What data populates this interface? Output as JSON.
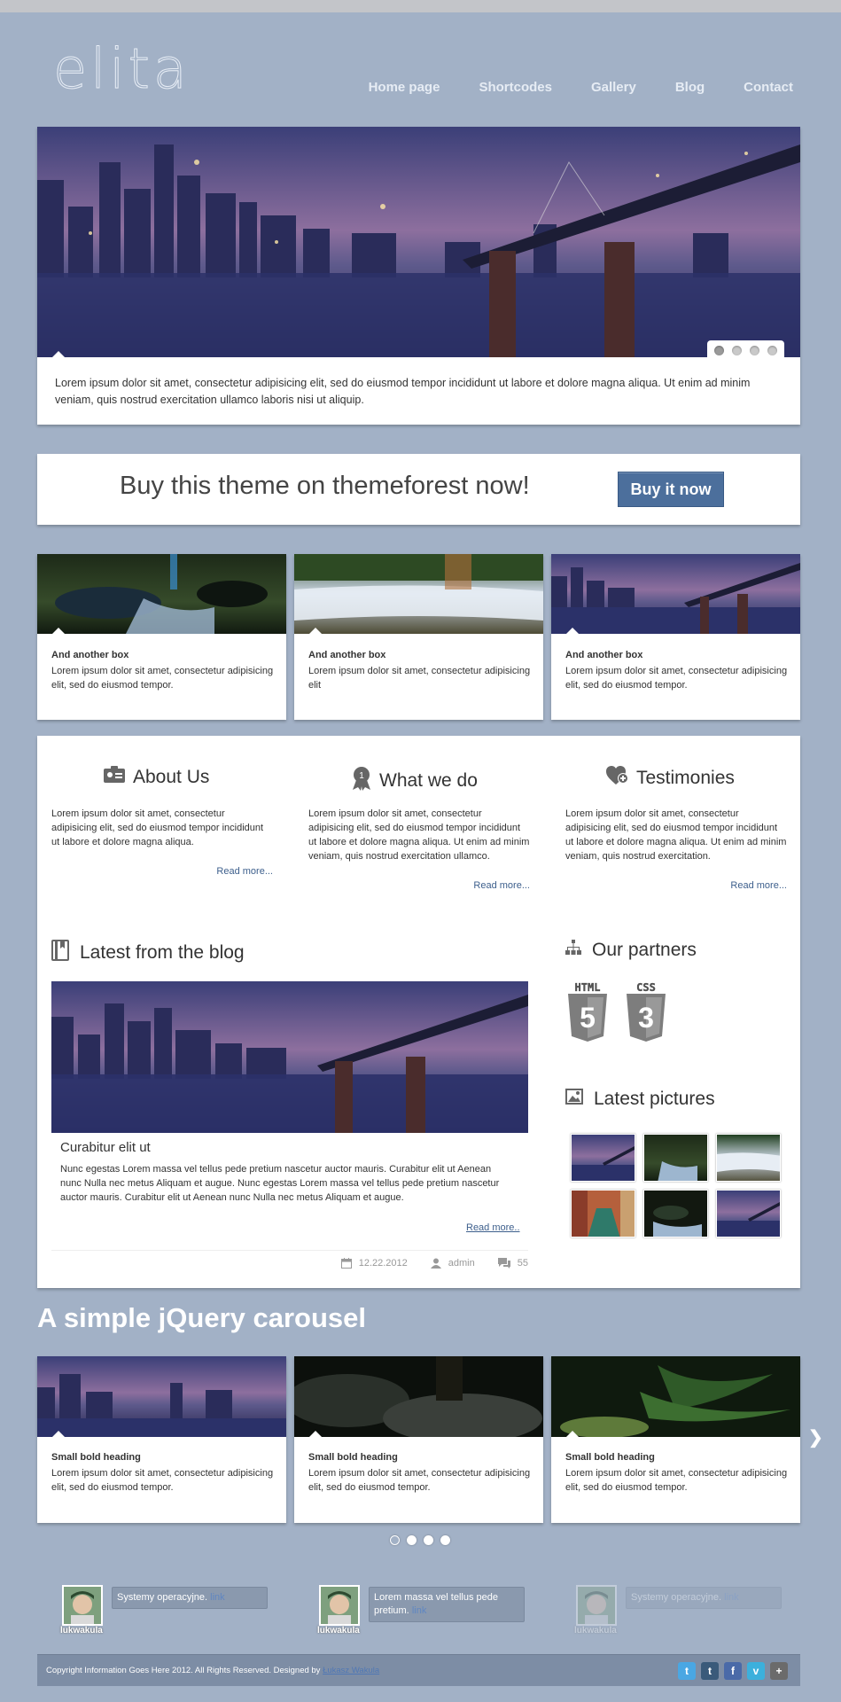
{
  "brand": {
    "logo": "elita"
  },
  "nav": {
    "items": [
      "Home page",
      "Shortcodes",
      "Gallery",
      "Blog",
      "Contact"
    ]
  },
  "slider": {
    "caption": "Lorem ipsum dolor sit amet, consectetur adipisicing elit, sed do eiusmod tempor incididunt ut labore et dolore magna aliqua. Ut enim ad minim veniam, quis nostrud exercitation ullamco laboris nisi ut aliquip.",
    "active_slide": 1,
    "slide_count": 4
  },
  "promo": {
    "text": "Buy this theme on themeforest now!",
    "button": "Buy it now"
  },
  "boxes": [
    {
      "title": "And another box",
      "text": "Lorem ipsum dolor sit amet, consectetur adipisicing elit, sed do eiusmod tempor.",
      "image": "river-stones"
    },
    {
      "title": "And another box",
      "text": "Lorem ipsum dolor sit amet, consectetur adipisicing elit",
      "image": "waterfall"
    },
    {
      "title": "And another box",
      "text": "Lorem ipsum dolor sit amet, consectetur adipisicing elit, sed do eiusmod tempor.",
      "image": "city-bridge"
    }
  ],
  "features": [
    {
      "title": "About Us",
      "icon": "id-card-icon",
      "text": "Lorem ipsum dolor sit amet, consectetur adipisicing elit, sed do eiusmod tempor incididunt ut labore et dolore magna aliqua.",
      "link": "Read more..."
    },
    {
      "title": "What we do",
      "icon": "award-icon",
      "text": "Lorem ipsum dolor sit amet, consectetur adipisicing elit, sed do eiusmod tempor incididunt ut labore et dolore magna aliqua. Ut enim ad minim veniam, quis nostrud exercitation ullamco.",
      "link": "Read more..."
    },
    {
      "title": "Testimonies",
      "icon": "heart-plus-icon",
      "text": "Lorem ipsum dolor sit amet, consectetur adipisicing elit, sed do eiusmod tempor incididunt ut labore et dolore magna aliqua. Ut enim ad minim veniam, quis nostrud exercitation.",
      "link": "Read more..."
    }
  ],
  "blog": {
    "heading": "Latest from the blog",
    "post_title": "Curabitur elit ut",
    "post_text": "Nunc egestas Lorem massa vel tellus pede pretium nascetur auctor mauris. Curabitur elit ut Aenean nunc Nulla nec metus Aliquam et augue. Nunc egestas Lorem massa vel tellus pede pretium nascetur auctor mauris. Curabitur elit ut Aenean nunc Nulla nec metus Aliquam et augue.",
    "read_more": "Read more..",
    "date": "12.22.2012",
    "author": "admin",
    "comments": "55"
  },
  "partners": {
    "heading": "Our partners",
    "logos": [
      "HTML",
      "CSS"
    ],
    "numbers": [
      "5",
      "3"
    ]
  },
  "pictures": {
    "heading": "Latest pictures",
    "thumbs": [
      "city-bridge",
      "river-stones",
      "waterfall",
      "canal",
      "river-stones",
      "city-bridge"
    ]
  },
  "carousel": {
    "title": "A simple jQuery carousel",
    "items": [
      {
        "title": "Small bold heading",
        "text": "Lorem ipsum dolor sit amet, consectetur adipisicing elit, sed do eiusmod tempor.",
        "image": "city-bridge"
      },
      {
        "title": "Small bold heading",
        "text": "Lorem ipsum dolor sit amet, consectetur adipisicing elit, sed do eiusmod tempor.",
        "image": "dark-rocks"
      },
      {
        "title": "Small bold heading",
        "text": "Lorem ipsum dolor sit amet, consectetur adipisicing elit, sed do eiusmod tempor.",
        "image": "ferns"
      }
    ],
    "next_icon": "chevron-right-icon",
    "page_count": 4,
    "active_page": 1
  },
  "tweets": [
    {
      "user": "lukwakula",
      "text": "Systemy operacyjne.",
      "link": "link"
    },
    {
      "user": "lukwakula",
      "text": "Lorem massa vel tellus pede pretium.",
      "link": "link"
    },
    {
      "user": "lukwakula",
      "text": "Systemy operacyjne.",
      "link": "link"
    }
  ],
  "footer": {
    "copyright": "Copyright Information Goes Here 2012. All Rights Reserved. Designed by",
    "designer": "Łukasz Wakula",
    "social": [
      {
        "icon": "twitter-icon",
        "glyph": "t",
        "color": "#4aa7e3"
      },
      {
        "icon": "tumblr-icon",
        "glyph": "t",
        "color": "#3a5a7a"
      },
      {
        "icon": "facebook-icon",
        "glyph": "f",
        "color": "#4a6aa8"
      },
      {
        "icon": "vimeo-icon",
        "glyph": "v",
        "color": "#3cb0dc"
      },
      {
        "icon": "googleplus-icon",
        "glyph": "+",
        "color": "#6b6b6b"
      }
    ]
  }
}
